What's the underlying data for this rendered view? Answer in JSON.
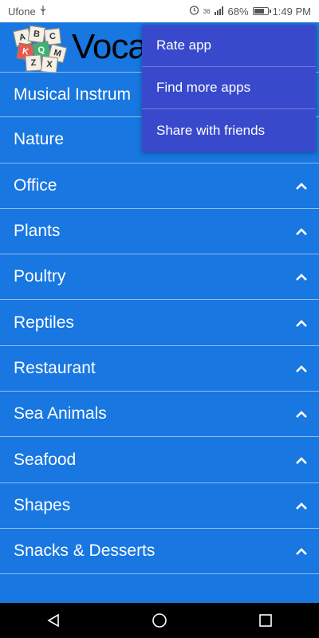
{
  "status": {
    "carrier": "Ufone",
    "usb_icon": "usb-icon",
    "alarm_icon": "alarm-icon",
    "network": "36",
    "battery_pct": "68%",
    "battery_level": 0.68,
    "time": "1:49 PM"
  },
  "appbar": {
    "title": "Voca",
    "logo_icon": "letter-tiles-logo"
  },
  "categories": [
    {
      "label": "Musical Instrum"
    },
    {
      "label": "Nature"
    },
    {
      "label": "Office"
    },
    {
      "label": "Plants"
    },
    {
      "label": "Poultry"
    },
    {
      "label": "Reptiles"
    },
    {
      "label": "Restaurant"
    },
    {
      "label": "Sea Animals"
    },
    {
      "label": "Seafood"
    },
    {
      "label": "Shapes"
    },
    {
      "label": "Snacks & Desserts"
    }
  ],
  "menu": {
    "items": [
      {
        "label": "Rate app"
      },
      {
        "label": "Find more apps"
      },
      {
        "label": "Share with friends"
      }
    ]
  },
  "navbar": {
    "back_icon": "back-triangle-icon",
    "home_icon": "home-circle-icon",
    "recents_icon": "recents-square-icon"
  },
  "colors": {
    "background": "#1877e0",
    "menu": "#3949cc",
    "divider": "#8fbef2",
    "navbar": "#000000"
  }
}
